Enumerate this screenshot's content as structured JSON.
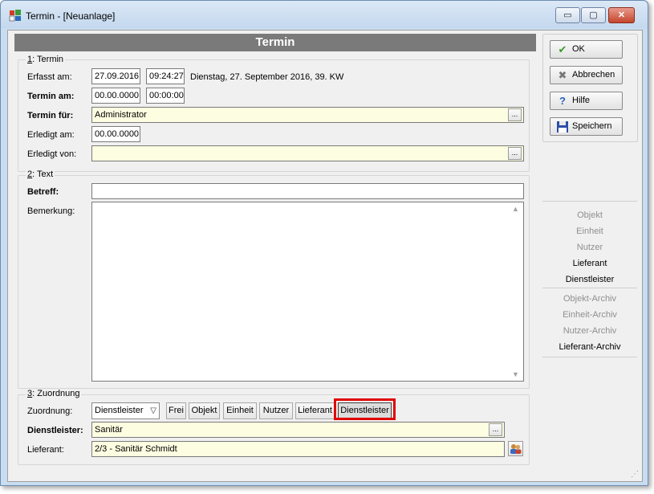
{
  "window": {
    "title": "Termin - [Neuanlage]",
    "min_label": "▭",
    "max_label": "▢",
    "close_label": "✕"
  },
  "header": {
    "title": "Termin"
  },
  "group1": {
    "legend_num": "1",
    "legend_text": ": Termin",
    "erfasst_label": "Erfasst am:",
    "erfasst_date": "27.09.2016",
    "erfasst_time": "09:24:27",
    "erfasst_info": "Dienstag,  27. September 2016,  39. KW",
    "termin_am_label": "Termin am:",
    "termin_am_date": "00.00.0000",
    "termin_am_time": "00:00:00",
    "termin_fuer_label": "Termin für:",
    "termin_fuer_value": "Administrator",
    "erledigt_am_label": "Erledigt am:",
    "erledigt_am_value": "00.00.0000",
    "erledigt_von_label": "Erledigt von:",
    "erledigt_von_value": "",
    "ellipsis": "..."
  },
  "group2": {
    "legend_num": "2",
    "legend_text": ": Text",
    "betreff_label": "Betreff:",
    "betreff_value": "",
    "bemerkung_label": "Bemerkung:",
    "bemerkung_value": ""
  },
  "group3": {
    "legend_num": "3",
    "legend_text": ": Zuordnung",
    "zuordnung_label": "Zuordnung:",
    "zuordnung_value": "Dienstleister",
    "tabs": [
      "Frei",
      "Objekt",
      "Einheit",
      "Nutzer",
      "Lieferant",
      "Dienstleister"
    ],
    "dienstleister_label": "Dienstleister:",
    "dienstleister_value": "Sanitär",
    "lieferant_label": "Lieferant:",
    "lieferant_value": "2/3 - Sanitär Schmidt"
  },
  "buttons": {
    "ok": "OK",
    "abbrechen": "Abbrechen",
    "hilfe": "Hilfe",
    "speichern": "Speichern"
  },
  "side_list": {
    "items": [
      {
        "label": "Objekt",
        "enabled": false
      },
      {
        "label": "Einheit",
        "enabled": false
      },
      {
        "label": "Nutzer",
        "enabled": false
      },
      {
        "label": "Lieferant",
        "enabled": true
      },
      {
        "label": "Dienstleister",
        "enabled": true
      }
    ],
    "archive_items": [
      {
        "label": "Objekt-Archiv",
        "enabled": false
      },
      {
        "label": "Einheit-Archiv",
        "enabled": false
      },
      {
        "label": "Nutzer-Archiv",
        "enabled": false
      },
      {
        "label": "Lieferant-Archiv",
        "enabled": true
      }
    ]
  },
  "colors": {
    "header_bar": "#7a7a7a",
    "field_yellow": "#fdfde1",
    "highlight": "#e00000",
    "ok_icon": "#3a9a2a",
    "help_icon": "#2a5fbf"
  },
  "icons": [
    "app-icon",
    "checkmark-icon",
    "cross-icon",
    "help-icon",
    "floppy-disk-icon",
    "people-icon"
  ]
}
